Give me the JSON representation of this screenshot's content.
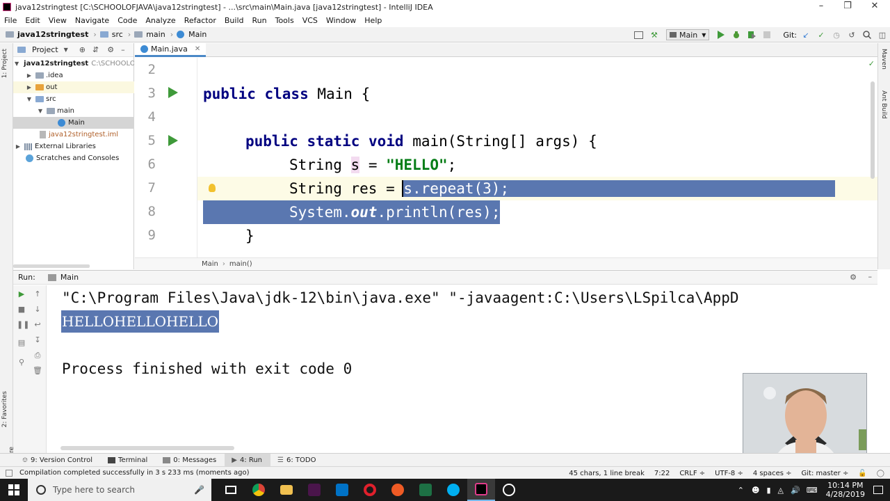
{
  "window": {
    "title": "java12stringtest [C:\\SCHOOLOFJAVA\\java12stringtest] - ...\\src\\main\\Main.java [java12stringtest] - IntelliJ IDEA",
    "controls": [
      "–",
      "❐",
      "✕"
    ]
  },
  "menu": [
    "File",
    "Edit",
    "View",
    "Navigate",
    "Code",
    "Analyze",
    "Refactor",
    "Build",
    "Run",
    "Tools",
    "VCS",
    "Window",
    "Help"
  ],
  "nav": {
    "crumbs": [
      "java12stringtest",
      "src",
      "main",
      "Main"
    ],
    "run_config": "Main",
    "git_label": "Git:"
  },
  "left_strip": {
    "project_tab": "1: Project",
    "favorites_tab": "2: Favorites",
    "structure_tab": "Z: Structure"
  },
  "right_strip": {
    "maven_tab": "Maven",
    "ant_tab": "Ant Build"
  },
  "project": {
    "header": "Project",
    "tree": [
      {
        "label": "java12stringtest",
        "suffix": "C:\\SCHOOLOFJAVA",
        "bold": true
      },
      {
        "label": ".idea"
      },
      {
        "label": "out"
      },
      {
        "label": "src"
      },
      {
        "label": "main"
      },
      {
        "label": "Main"
      },
      {
        "label": "java12stringtest.iml"
      },
      {
        "label": "External Libraries"
      },
      {
        "label": "Scratches and Consoles"
      }
    ]
  },
  "editor": {
    "tab_label": "Main.java",
    "line_numbers": [
      "2",
      "3",
      "4",
      "5",
      "6",
      "7",
      "8",
      "9"
    ],
    "code": {
      "l3_kw": "public class ",
      "l3_rest": "Main {",
      "l5_kw": "public static void ",
      "l5_rest": "main(String[] args) {",
      "l6_a": "String ",
      "l6_var": "s",
      "l6_b": " = ",
      "l6_str": "\"HELLO\"",
      "l6_c": ";",
      "l7_a": "String res = ",
      "l7_sel": "s.repeat(3);",
      "l8_a": "System.",
      "l8_fld": "out",
      "l8_b": ".println(res);",
      "l9": "}"
    },
    "breadcrumb": [
      "Main",
      "main()"
    ]
  },
  "run": {
    "label": "Run:",
    "config": "Main",
    "console": {
      "cmd": "\"C:\\Program Files\\Java\\jdk-12\\bin\\java.exe\" \"-javaagent:C:\\Users\\LSpilca\\AppD",
      "output": "HELLOHELLOHELLO",
      "exit": "Process finished with exit code 0"
    }
  },
  "bottom_tabs": [
    "9: Version Control",
    "Terminal",
    "0: Messages",
    "4: Run",
    "6: TODO"
  ],
  "status": {
    "message": "Compilation completed successfully in 3 s 233 ms (moments ago)",
    "chars": "45 chars, 1 line break",
    "position": "7:22",
    "line_sep": "CRLF ÷",
    "encoding": "UTF-8 ÷",
    "indent": "4 spaces ÷",
    "git": "Git: master ÷"
  },
  "taskbar": {
    "search_placeholder": "Type here to search",
    "time": "10:14 PM",
    "date": "4/28/2019"
  }
}
